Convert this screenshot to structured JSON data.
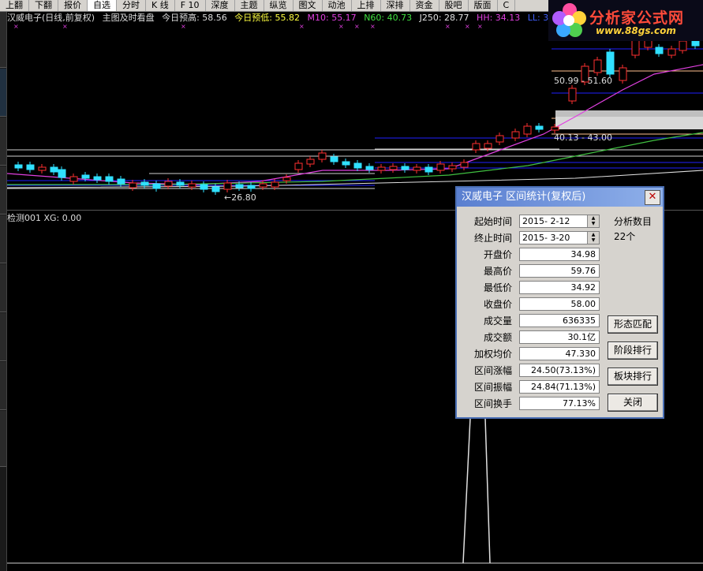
{
  "menubar": {
    "items": [
      "上翻",
      "下翻",
      "报价",
      "自选",
      "分时",
      "K 线",
      "F 10",
      "深度",
      "主题",
      "纵览",
      "图文",
      "动池",
      "上排",
      "深排",
      "资金",
      "股吧",
      "版面",
      "C"
    ]
  },
  "infobar": {
    "stock_title": "汉威电子(日线,前复权)",
    "main_chart": "主图及时看盘",
    "forecast_high": "今日预高: 58.56",
    "forecast_low": "今日预低: 55.82",
    "m10": "M10: 55.17",
    "n60": "N60: 40.73",
    "j250": "J250: 28.77",
    "hh": "HH: 34.13",
    "ll": "LL: 3"
  },
  "logo": {
    "brand": "分析家公式网",
    "url": "www.88gs.com"
  },
  "chart": {
    "range_labels": [
      "50.99 - 51.60",
      "40.13 - 43.00"
    ],
    "low_marker": "←26.80"
  },
  "indicator": {
    "label": "检测001  XG: 0.00"
  },
  "colors": {
    "up": "#ff3030",
    "down": "#30e0ff",
    "ma_magenta": "#e040e0",
    "ma_green": "#40c040",
    "ma_white": "#e0e0e0",
    "hline_blue": "#2020ff"
  },
  "dialog": {
    "title": "汉威电子  区间统计(复权后)",
    "start_label": "起始时间",
    "start_value": "2015- 2-12",
    "end_label": "终止时间",
    "end_value": "2015- 3-20",
    "count_label": "分析数目",
    "count_value": "22个",
    "rows": [
      {
        "label": "开盘价",
        "value": "34.98"
      },
      {
        "label": "最高价",
        "value": "59.76"
      },
      {
        "label": "最低价",
        "value": "34.92"
      },
      {
        "label": "收盘价",
        "value": "58.00"
      },
      {
        "label": "成交量",
        "value": "636335"
      },
      {
        "label": "成交额",
        "value": "30.1亿"
      },
      {
        "label": "加权均价",
        "value": "47.330"
      },
      {
        "label": "区间涨幅",
        "value": "24.50(73.13%)"
      },
      {
        "label": "区间振幅",
        "value": "24.84(71.13%)"
      },
      {
        "label": "区间换手",
        "value": "77.13%"
      }
    ],
    "buttons": {
      "pattern": "形态匹配",
      "stage_rank": "阶段排行",
      "sector_rank": "板块排行",
      "close": "关闭"
    }
  }
}
